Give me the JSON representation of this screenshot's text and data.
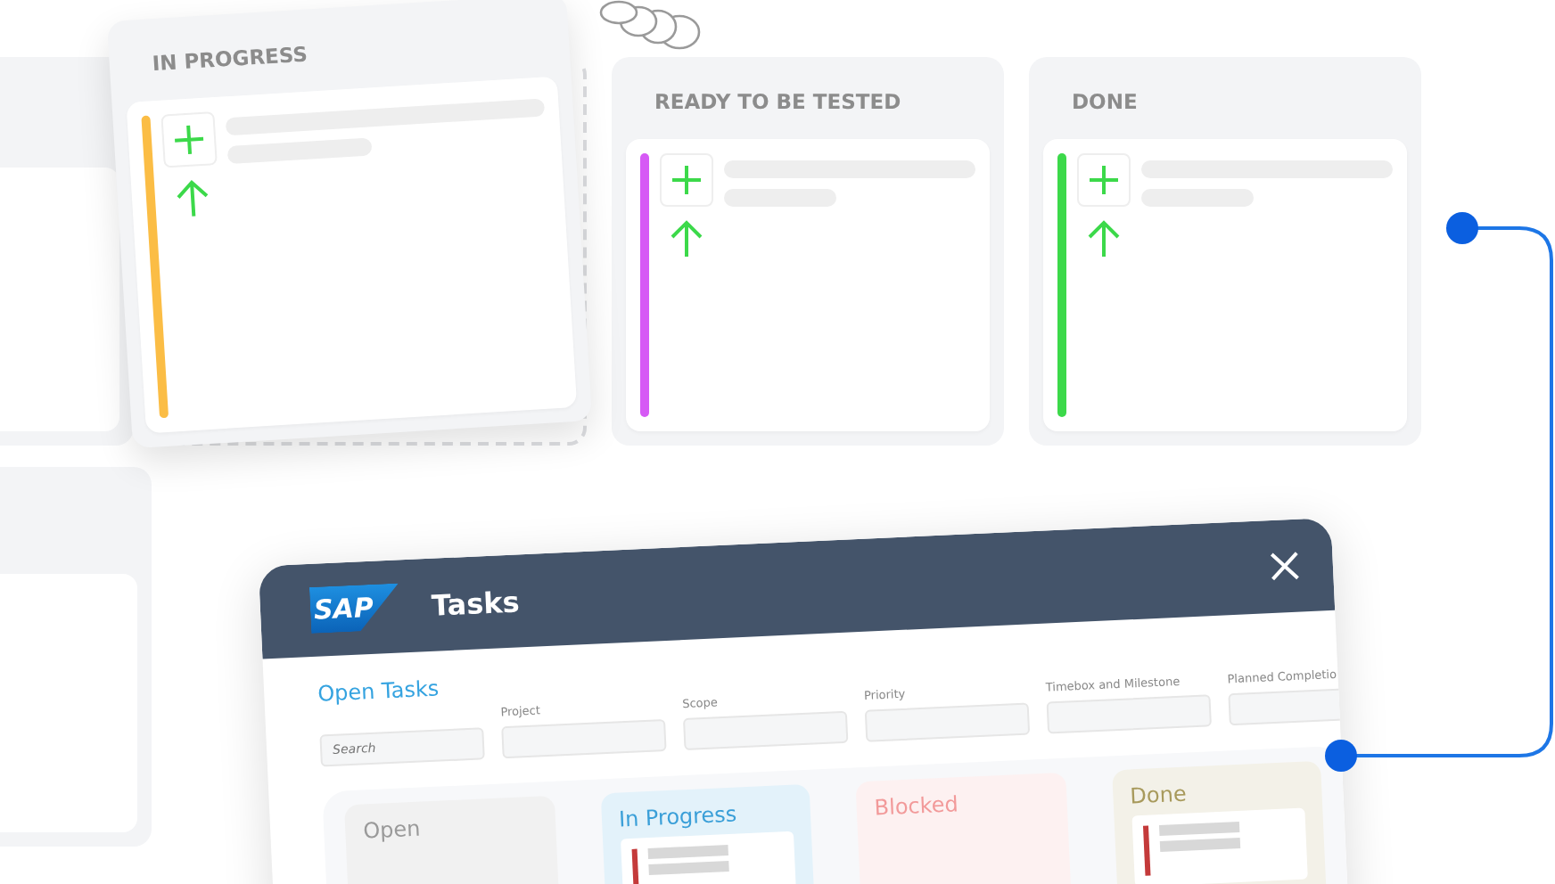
{
  "board": {
    "columns": [
      {
        "title": "IN PROGRESS",
        "dragging": true,
        "card": {
          "color": "#fbbd45"
        }
      },
      {
        "title": "READY TO BE TESTED",
        "dragging": false,
        "card": {
          "color": "#d65af5"
        }
      },
      {
        "title": "DONE",
        "dragging": false,
        "card": {
          "color": "#3cd94a"
        }
      }
    ]
  },
  "dialog": {
    "logo": "SAP",
    "title": "Tasks",
    "view": "Open Tasks",
    "search": {
      "placeholder": "Search"
    },
    "filters": [
      {
        "label": "Project"
      },
      {
        "label": "Scope"
      },
      {
        "label": "Priority"
      },
      {
        "label": "Timebox and Milestone"
      },
      {
        "label": "Planned Completio"
      }
    ],
    "lanes": [
      {
        "title": "Open",
        "color": "#9a9a9a"
      },
      {
        "title": "In Progress",
        "color": "#3a9fd8"
      },
      {
        "title": "Blocked",
        "color": "#f29a9a"
      },
      {
        "title": "Done",
        "color": "#a89a5c"
      }
    ]
  }
}
